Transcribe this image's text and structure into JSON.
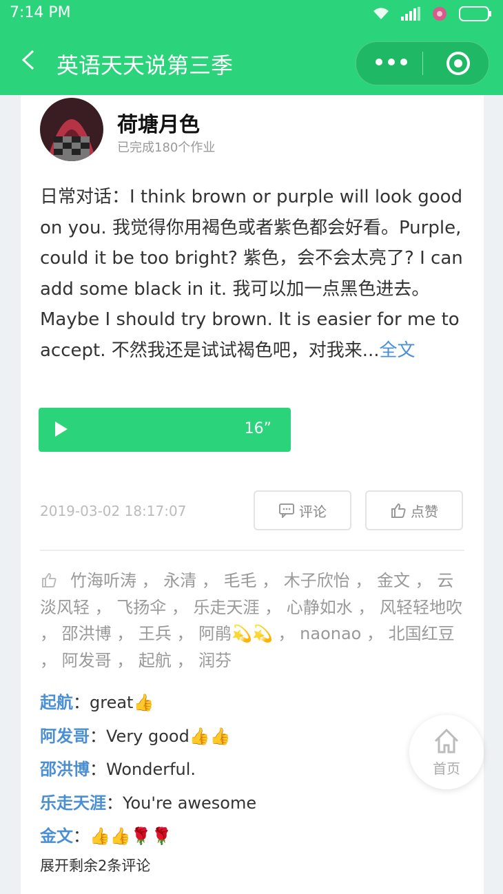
{
  "status": {
    "time": "7:14 PM"
  },
  "nav": {
    "title": "英语天天说第三季"
  },
  "post": {
    "author": "荷塘月色",
    "subtitle": "已完成180个作业",
    "text": "日常对话：I think brown or purple will look good on you. 我觉得你用褐色或者紫色都会好看。Purple, could it be too bright? 紫色，会不会太亮了? I can add some black in it. 我可以加一点黑色进去。Maybe I should try brown. It is easier for me to accept. 不然我还是试试褐色吧，对我来...",
    "more": "全文",
    "audio_duration": "16”",
    "timestamp": "2019-03-02 18:17:07",
    "comment_btn": "评论",
    "like_btn": "点赞"
  },
  "likers": "竹海听涛 ， 永清 ， 毛毛 ， 木子欣怡 ， 金文 ， 云淡风轻 ， 飞扬伞 ， 乐走天涯 ， 心静如水 ， 风轻轻地吹 ， 邵洪博 ， 王兵 ， 阿鹃💫💫 ， naonao ， 北国红豆 ， 阿发哥 ， 起航 ， 润芬",
  "comments": [
    {
      "name": "起航",
      "text": "：great👍"
    },
    {
      "name": "阿发哥",
      "text": "：Very good👍👍"
    },
    {
      "name": "邵洪博",
      "text": "：Wonderful."
    },
    {
      "name": "乐走天涯",
      "text": "：You're awesome"
    },
    {
      "name": "金文",
      "text": "：👍👍🌹🌹"
    }
  ],
  "expand": "展开剩余2条评论",
  "home_label": "首页",
  "colors": {
    "brand": "#2bd47b",
    "link": "#4a8fd3"
  }
}
